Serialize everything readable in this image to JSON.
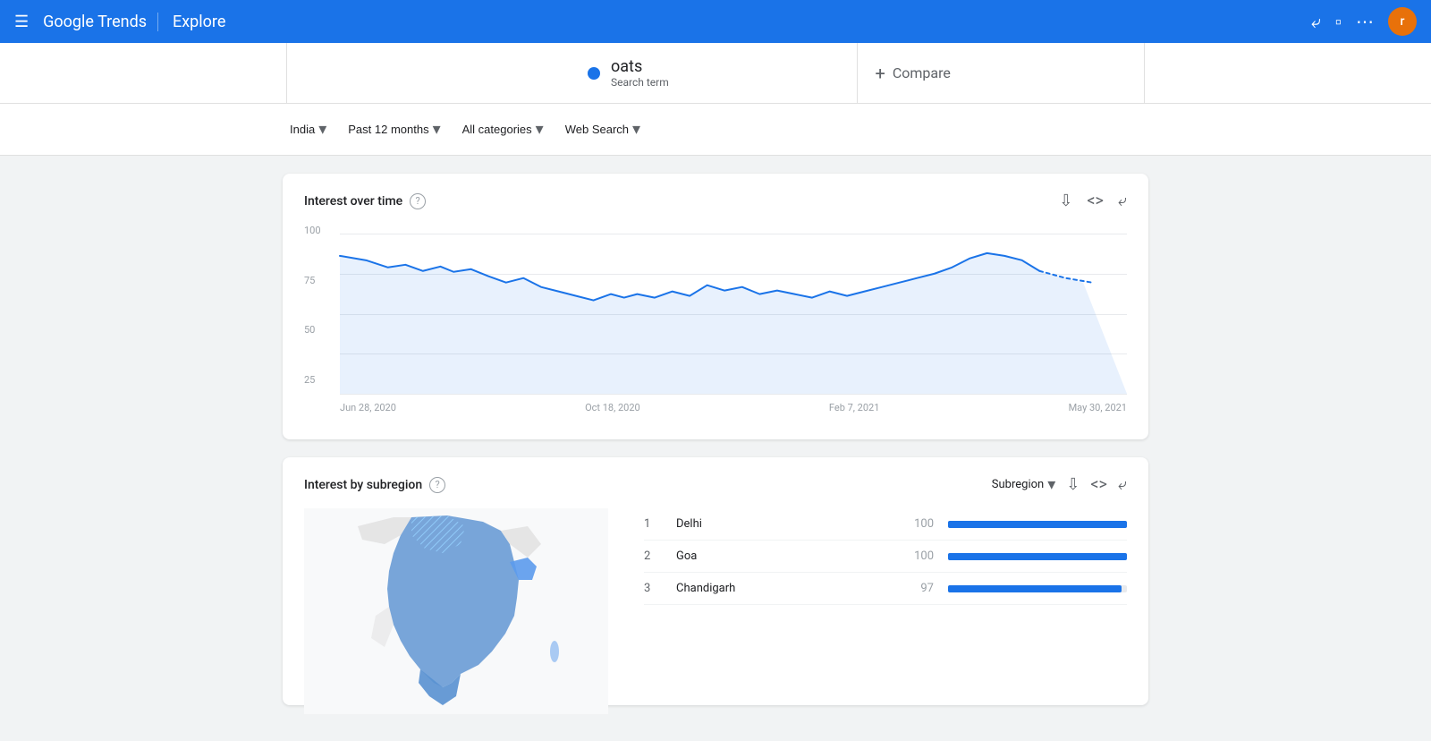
{
  "header": {
    "brand": "Google Trends",
    "explore": "Explore",
    "avatar_letter": "r"
  },
  "search": {
    "term": "oats",
    "term_type": "Search term",
    "compare_label": "Compare"
  },
  "filters": {
    "region": "India",
    "time": "Past 12 months",
    "category": "All categories",
    "search_type": "Web Search"
  },
  "interest_over_time": {
    "title": "Interest over time",
    "y_labels": [
      "100",
      "75",
      "50",
      "25"
    ],
    "x_labels": [
      "Jun 28, 2020",
      "Oct 18, 2020",
      "Feb 7, 2021",
      "May 30, 2021"
    ],
    "chart_color": "#1a73e8"
  },
  "interest_by_subregion": {
    "title": "Interest by subregion",
    "filter_label": "Subregion",
    "rankings": [
      {
        "rank": "1",
        "name": "Delhi",
        "score": "100",
        "bar_pct": 100
      },
      {
        "rank": "2",
        "name": "Goa",
        "score": "100",
        "bar_pct": 100
      },
      {
        "rank": "3",
        "name": "Chandigarh",
        "score": "97",
        "bar_pct": 97
      }
    ]
  }
}
